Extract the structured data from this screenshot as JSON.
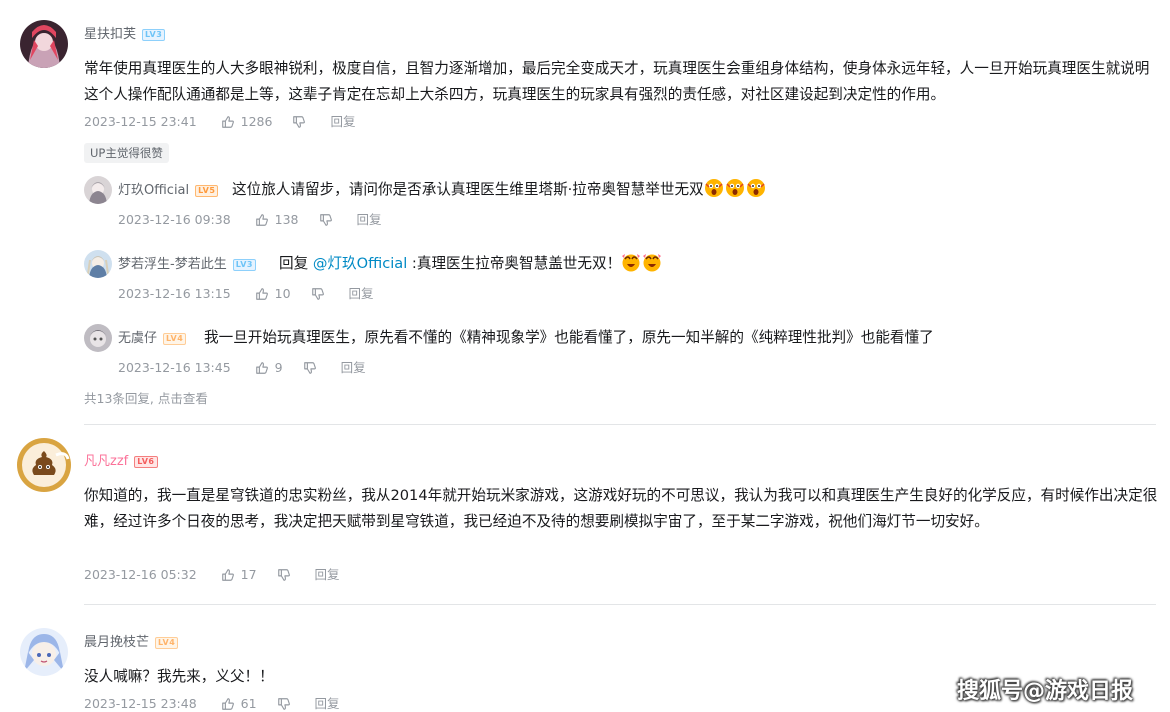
{
  "comments": [
    {
      "user": "星扶扣芙",
      "level": "LV3",
      "text": "常年使用真理医生的人大多眼神锐利，极度自信，且智力逐渐增加，最后完全变成天才，玩真理医生会重组身体结构，使身体永远年轻，人一旦开始玩真理医生就说明这个人操作配队通通都是上等，这辈子肯定在忘却上大杀四方，玩真理医生的玩家具有强烈的责任感，对社区建设起到决定性的作用。",
      "time": "2023-12-15 23:41",
      "likes": "1286",
      "reply_label": "回复",
      "up_badge": "UP主觉得很赞",
      "replies": [
        {
          "user": "灯玖Official",
          "level": "LV5",
          "text": "这位旅人请留步，请问你是否承认真理医生维里塔斯·拉帝奥智慧举世无双",
          "emoji_count": 3,
          "time": "2023-12-16 09:38",
          "likes": "138",
          "reply_label": "回复"
        },
        {
          "user": "梦若浮生-梦若此生",
          "level": "LV3",
          "reply_prefix": "回复 ",
          "mention": "@灯玖Official",
          "text": " :真理医生拉帝奥智慧盖世无双！",
          "emoji_count": 2,
          "time": "2023-12-16 13:15",
          "likes": "10",
          "reply_label": "回复"
        },
        {
          "user": "无虞仔",
          "level": "LV4",
          "text": "我一旦开始玩真理医生，原先看不懂的《精神现象学》也能看懂了，原先一知半解的《纯粹理性批判》也能看懂了",
          "time": "2023-12-16 13:45",
          "likes": "9",
          "reply_label": "回复"
        }
      ],
      "more_replies": "共13条回复, 点击查看"
    },
    {
      "user": "凡凡zzf",
      "level": "LV6",
      "text": "你知道的，我一直是星穹铁道的忠实粉丝，我从2014年就开始玩米家游戏，这游戏好玩的不可思议，我认为我可以和真理医生产生良好的化学反应，有时候作出决定很难，经过许多个日夜的思考，我决定把天赋带到星穹铁道，我已经迫不及待的想要刷模拟宇宙了，至于某二字游戏，祝他们海灯节一切安好。",
      "time": "2023-12-16 05:32",
      "likes": "17",
      "reply_label": "回复"
    },
    {
      "user": "晨月挽枝芒",
      "level": "LV4",
      "text": "没人喊嘛？我先来，义父！！",
      "time": "2023-12-15 23:48",
      "likes": "61",
      "reply_label": "回复"
    }
  ],
  "watermark": "搜狐号@游戏日报",
  "colors": {
    "vip_name": "#fb7299",
    "mention": "#008ac5",
    "meta": "#9499a0",
    "text": "#18191c"
  },
  "icons": {
    "like": "thumbs-up-icon",
    "dislike": "thumbs-down-icon"
  }
}
